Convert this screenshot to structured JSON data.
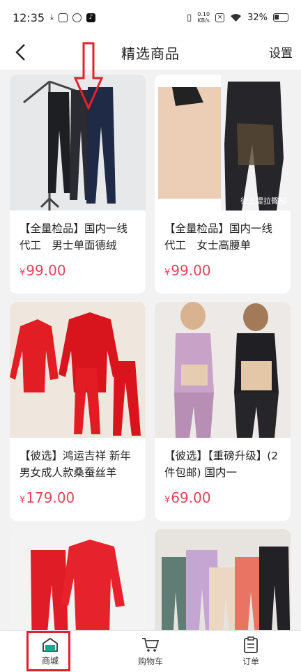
{
  "status_bar": {
    "time": "12:35",
    "net_speed_top": "0.10",
    "net_speed_bottom": "KB/s",
    "battery": "32%"
  },
  "nav": {
    "title": "精选商品",
    "settings_label": "设置"
  },
  "products": [
    {
      "name": "【全量检品】国内一线代工　男士单面德绒",
      "yen": "¥",
      "price": "99.00"
    },
    {
      "name": "【全量检品】国内一线代工　女士高腰单",
      "yen": "¥",
      "price": "99.00",
      "image_caption": "往上提拉臀部"
    },
    {
      "name": "【彼选】鸿运吉祥 新年男女成人款桑蚕丝羊",
      "yen": "¥",
      "price": "179.00"
    },
    {
      "name": "【彼选】【重磅升级】(2件包邮) 国内一",
      "yen": "¥",
      "price": "69.00"
    }
  ],
  "tabs": [
    {
      "label": "商城",
      "icon": "store-icon",
      "active": true
    },
    {
      "label": "购物车",
      "icon": "cart-icon",
      "active": false
    },
    {
      "label": "订单",
      "icon": "clipboard-icon",
      "active": false
    }
  ],
  "colors": {
    "price": "#e0445b",
    "annotation": "#e0222f"
  }
}
